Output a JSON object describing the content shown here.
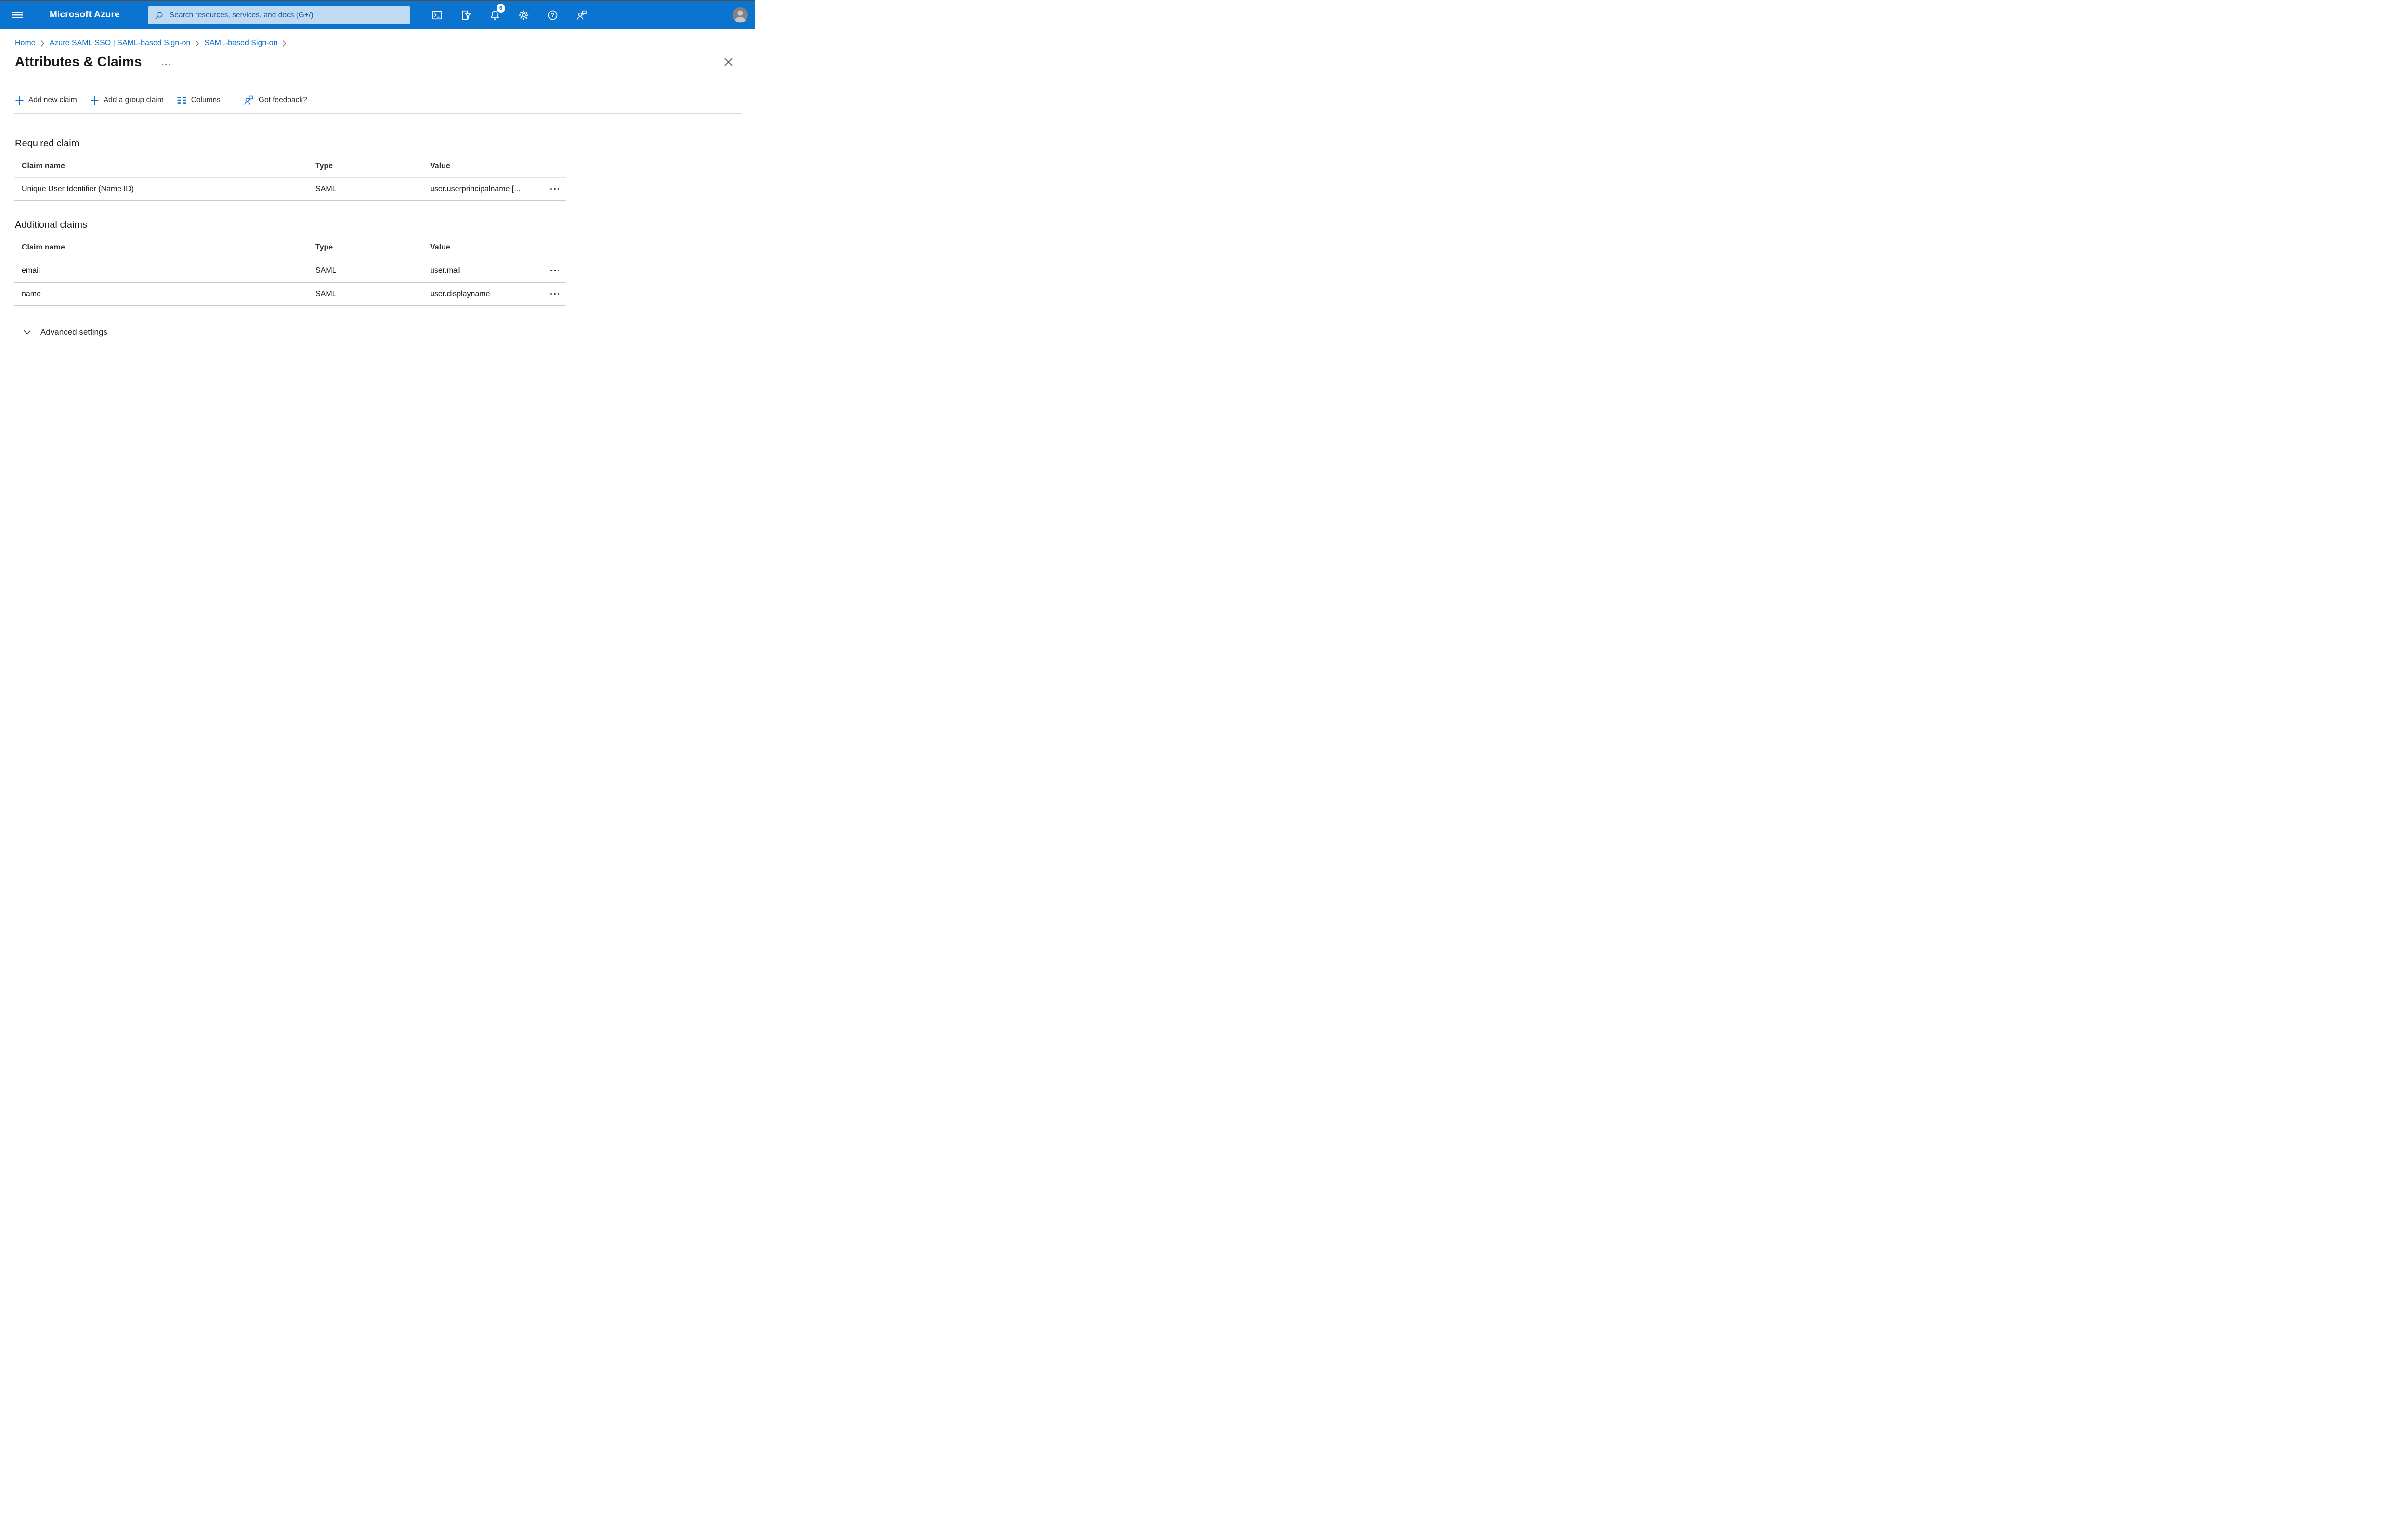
{
  "topbar": {
    "brand": "Microsoft Azure",
    "search": {
      "placeholder": "Search resources, services, and docs (G+/)"
    },
    "notifications_badge": "6"
  },
  "breadcrumb": {
    "items": [
      {
        "label": "Home"
      },
      {
        "label": "Azure SAML SSO | SAML-based Sign-on"
      },
      {
        "label": "SAML-based Sign-on"
      }
    ]
  },
  "page": {
    "title": "Attributes & Claims"
  },
  "toolbar": {
    "add_new_claim_label": "Add new claim",
    "add_group_claim_label": "Add a group claim",
    "columns_label": "Columns",
    "got_feedback_label": "Got feedback?"
  },
  "required_claim": {
    "heading": "Required claim",
    "columns": {
      "claim_name": "Claim name",
      "type": "Type",
      "value": "Value"
    },
    "rows": [
      {
        "claim_name": "Unique User Identifier (Name ID)",
        "type": "SAML",
        "value": "user.userprincipalname [..."
      }
    ]
  },
  "additional_claims": {
    "heading": "Additional claims",
    "columns": {
      "claim_name": "Claim name",
      "type": "Type",
      "value": "Value"
    },
    "rows": [
      {
        "claim_name": "email",
        "type": "SAML",
        "value": "user.mail"
      },
      {
        "claim_name": "name",
        "type": "SAML",
        "value": "user.displayname"
      }
    ]
  },
  "advanced_settings": {
    "label": "Advanced settings"
  },
  "colors": {
    "topbar_blue": "#0b74d1",
    "search_bg": "#bfdaf2",
    "search_text": "#1a5a96",
    "link_blue": "#0b74d1",
    "accent_blue": "#0078d4",
    "text_dark": "#201f1e",
    "divider_light": "#e9e7e5",
    "divider_row": "#cbcbcb"
  }
}
